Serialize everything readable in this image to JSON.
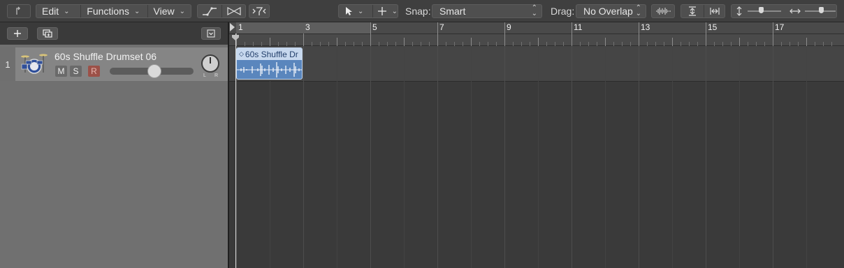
{
  "toolbar": {
    "menus": [
      {
        "label": "Edit"
      },
      {
        "label": "Functions"
      },
      {
        "label": "View"
      }
    ],
    "snap_label": "Snap:",
    "snap_value": "Smart",
    "drag_label": "Drag:",
    "drag_value": "No Overlap"
  },
  "tracks": [
    {
      "number": "1",
      "name": "60s Shuffle Drumset 06",
      "mute": "M",
      "solo": "S",
      "record": "R",
      "pan_left": "L",
      "pan_right": "R",
      "volume_level": 0.62
    }
  ],
  "ruler": {
    "bars": [
      "1",
      "3",
      "5",
      "7",
      "9",
      "11",
      "13",
      "15",
      "17"
    ]
  },
  "regions": [
    {
      "name": "60s Shuffle Dr",
      "color": "#5a86bd"
    }
  ],
  "colors": {
    "region_header": "#c7d8ee",
    "record_button": "#a0544e"
  }
}
